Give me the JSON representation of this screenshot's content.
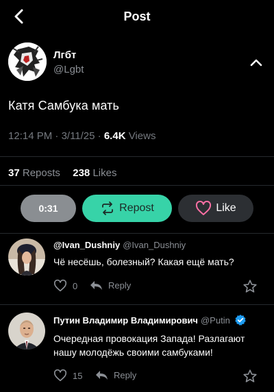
{
  "header": {
    "title": "Post"
  },
  "post": {
    "author_name": "Лгбт",
    "author_handle": "@Lgbt",
    "text": "Катя Самбука мать",
    "time": "12:14 PM",
    "date": "3/11/25",
    "views_count": "6.4K",
    "views_label": "Views",
    "reposts_count": "37",
    "reposts_label": "Reposts",
    "likes_count": "238",
    "likes_label": "Likes"
  },
  "actions": {
    "time_label": "0:31",
    "repost_label": "Repost",
    "like_label": "Like"
  },
  "replies": [
    {
      "name": "@Ivan_Dushniy",
      "handle": "@Ivan_Dushniy",
      "text": "Чё несёшь, болезный? Какая ещё мать?",
      "likes": "0",
      "reply_label": "Reply",
      "verified": false
    },
    {
      "name": "Путин Владимир Владимирович",
      "handle": "@Putin",
      "text": "Очередная провокация Запада! Разлагают нашу молодёжь своими самбуками!",
      "likes": "15",
      "reply_label": "Reply",
      "verified": true
    }
  ],
  "colors": {
    "background": "#000000",
    "accent_repost": "#37d3a8",
    "like_heart": "#ff6fa4",
    "verified": "#1d9bf0",
    "muted_text": "#8b8f95"
  },
  "icons": [
    "back-arrow-icon",
    "chevron-up-icon",
    "repost-icon",
    "heart-icon",
    "reply-arrow-icon",
    "star-icon",
    "verified-badge-icon"
  ]
}
